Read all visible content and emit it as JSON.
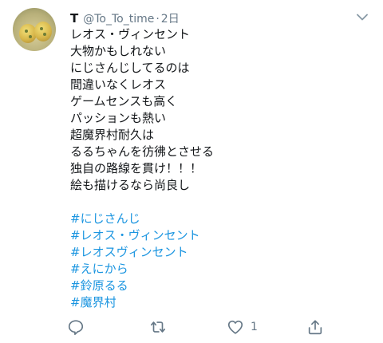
{
  "tweet": {
    "display_name": "T",
    "handle": "@To_To_time",
    "separator": "·",
    "time": "2日",
    "lines": [
      "レオス・ヴィンセント",
      "大物かもしれない",
      "にじさんじしてるのは",
      "間違いなくレオス",
      "ゲームセンスも高く",
      "パッションも熱い",
      "超魔界村耐久は",
      "るるちゃんを彷彿とさせる",
      "独自の路線を貫け！！！",
      "絵も描けるなら尚良し"
    ],
    "hashtags": [
      "#にじさんじ",
      "#レオス・ヴィンセント",
      "#レオスヴィンセント",
      "#えにから",
      "#鈴原るる",
      "#魔界村"
    ],
    "like_count": "1"
  },
  "colors": {
    "text": "#14171a",
    "secondary": "#657786",
    "link": "#1b95e0"
  },
  "icons": {
    "more": "chevron-down-icon",
    "reply": "reply-icon",
    "retweet": "retweet-icon",
    "like": "heart-icon",
    "share": "share-icon"
  }
}
